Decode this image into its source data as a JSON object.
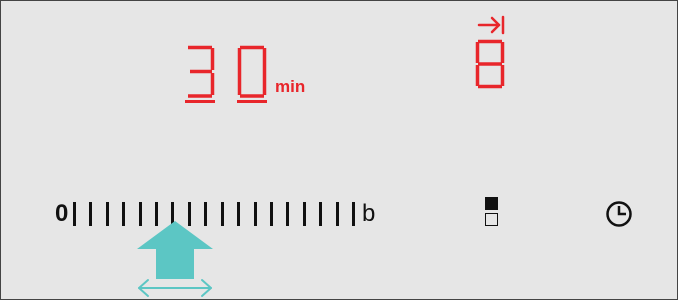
{
  "timer": {
    "digits": [
      "3",
      "0"
    ],
    "unit": "min"
  },
  "power_level": {
    "digit": "8",
    "indicator_icon": "arrow-to-bar-icon"
  },
  "slider": {
    "start_label": "0",
    "end_label": "b",
    "tick_count": 18
  },
  "controls": {
    "zone_select_icon": "filled-square-over-empty-square-icon",
    "timer_icon": "clock-icon"
  },
  "guide": {
    "press_icon": "up-arrow-icon",
    "swipe_icon": "left-right-arrow-icon"
  },
  "colors": {
    "display_red": "#e8262b",
    "panel_bg": "#e6e6e6",
    "guide_teal": "#5cc6c4",
    "ink": "#111111"
  }
}
